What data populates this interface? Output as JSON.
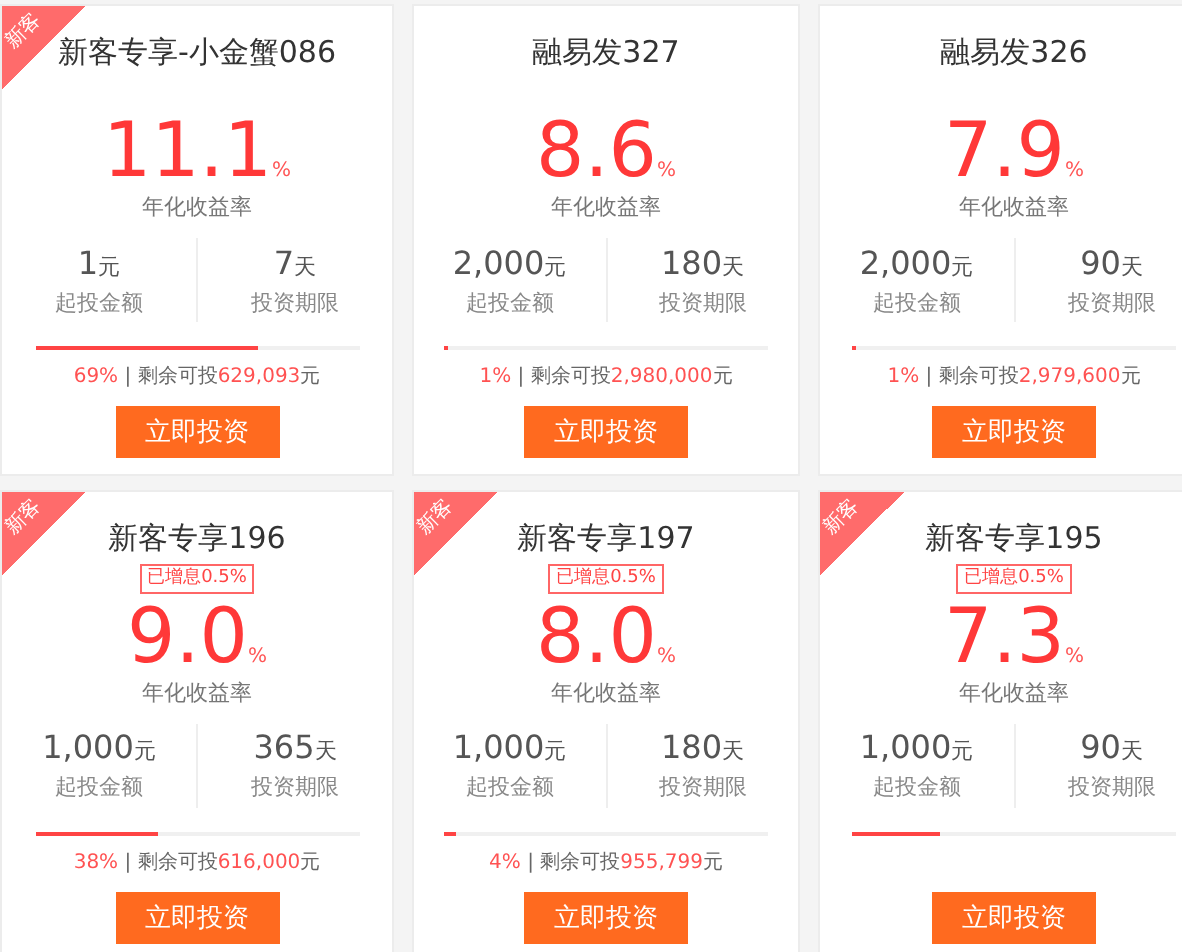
{
  "products": [
    {
      "new_customer": true,
      "corner_label": "新客",
      "title": "新客专享-小金蟹086",
      "rate": "11.1",
      "rate_unit": "%",
      "rate_label": "年化收益率",
      "stats": [
        {
          "value": "1",
          "unit": "元",
          "label": "起投金额"
        },
        {
          "value": "7",
          "unit": "天",
          "label": "投资期限"
        }
      ],
      "level": 0.69,
      "progress": {
        "percent": "69%",
        "sep": "|",
        "remaining_label": "剩余可投",
        "amount": "629,093",
        "unit": "元"
      },
      "button": "立即投资"
    },
    {
      "new_customer": false,
      "title": "融易发327",
      "rate": "8.6",
      "rate_unit": "%",
      "rate_label": "年化收益率",
      "stats": [
        {
          "value": "2,000",
          "unit": "元",
          "label": "起投金额"
        },
        {
          "value": "180",
          "unit": "天",
          "label": "投资期限"
        }
      ],
      "level": 0.01,
      "progress": {
        "percent": "1%",
        "sep": "|",
        "remaining_label": "剩余可投",
        "amount": "2,980,000",
        "unit": "元"
      },
      "button": "立即投资"
    },
    {
      "new_customer": false,
      "title": "融易发326",
      "rate": "7.9",
      "rate_unit": "%",
      "rate_label": "年化收益率",
      "stats": [
        {
          "value": "2,000",
          "unit": "元",
          "label": "起投金额"
        },
        {
          "value": "90",
          "unit": "天",
          "label": "投资期限"
        }
      ],
      "level": 0.01,
      "progress": {
        "percent": "1%",
        "sep": "|",
        "remaining_label": "剩余可投",
        "amount": "2,979,600",
        "unit": "元"
      },
      "button": "立即投资"
    },
    {
      "new_customer": true,
      "corner_label": "新客",
      "title": "新客专享196",
      "bonus": "已增息0.5%",
      "rate": "9.0",
      "rate_unit": "%",
      "rate_label": "年化收益率",
      "stats": [
        {
          "value": "1,000",
          "unit": "元",
          "label": "起投金额"
        },
        {
          "value": "365",
          "unit": "天",
          "label": "投资期限"
        }
      ],
      "level": 0.38,
      "progress": {
        "percent": "38%",
        "sep": "|",
        "remaining_label": "剩余可投",
        "amount": "616,000",
        "unit": "元"
      },
      "button": "立即投资"
    },
    {
      "new_customer": true,
      "corner_label": "新客",
      "title": "新客专享197",
      "bonus": "已增息0.5%",
      "rate": "8.0",
      "rate_unit": "%",
      "rate_label": "年化收益率",
      "stats": [
        {
          "value": "1,000",
          "unit": "元",
          "label": "起投金额"
        },
        {
          "value": "180",
          "unit": "天",
          "label": "投资期限"
        }
      ],
      "level": 0.04,
      "progress": {
        "percent": "4%",
        "sep": "|",
        "remaining_label": "剩余可投",
        "amount": "955,799",
        "unit": "元"
      },
      "button": "立即投资"
    },
    {
      "new_customer": true,
      "corner_label": "新客",
      "title": "新客专享195",
      "bonus": "已增息0.5%",
      "rate": "7.3",
      "rate_unit": "%",
      "rate_label": "年化收益率",
      "stats": [
        {
          "value": "1,000",
          "unit": "元",
          "label": "起投金额"
        },
        {
          "value": "90",
          "unit": "天",
          "label": "投资期限"
        }
      ],
      "level": 0.27,
      "button": "立即投资"
    }
  ]
}
